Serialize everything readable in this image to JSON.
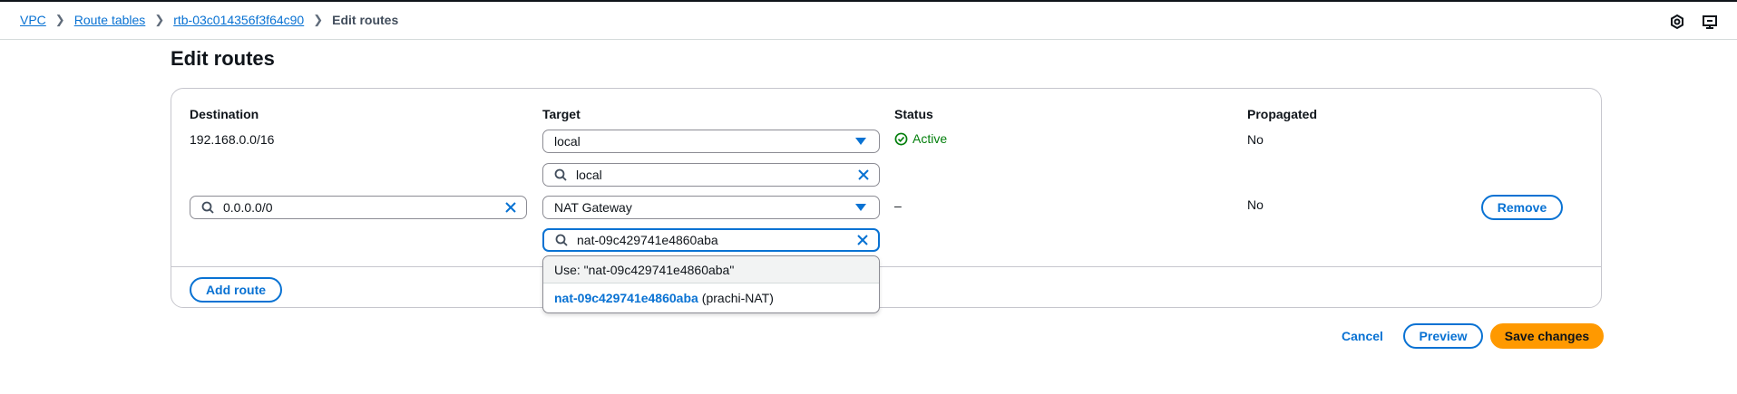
{
  "breadcrumbs": {
    "items": [
      "VPC",
      "Route tables",
      "rtb-03c014356f3f64c90"
    ],
    "current": "Edit routes"
  },
  "page_title": "Edit routes",
  "table": {
    "headers": {
      "destination": "Destination",
      "target": "Target",
      "status": "Status",
      "propagated": "Propagated"
    },
    "rows": [
      {
        "destination": "192.168.0.0/16",
        "target_type": "local",
        "target_search": "local",
        "status": "Active",
        "propagated": "No"
      },
      {
        "destination": "0.0.0.0/0",
        "target_type": "NAT Gateway",
        "target_search": "nat-09c429741e4860aba",
        "status": "–",
        "propagated": "No",
        "remove_label": "Remove"
      }
    ]
  },
  "dropdown": {
    "use_option": "Use: \"nat-09c429741e4860aba\"",
    "match_id": "nat-09c429741e4860aba",
    "match_name": "(prachi-NAT)"
  },
  "add_route_label": "Add route",
  "footer": {
    "cancel_label": "Cancel",
    "preview_label": "Preview",
    "save_label": "Save changes"
  },
  "colors": {
    "accent": "#0972d3",
    "primary_button": "#ff9900",
    "success": "#037f0c"
  },
  "icons": [
    "chevron-right-icon",
    "search-icon",
    "clear-icon",
    "caret-down-icon",
    "status-success-icon",
    "settings-icon",
    "feedback-icon"
  ]
}
